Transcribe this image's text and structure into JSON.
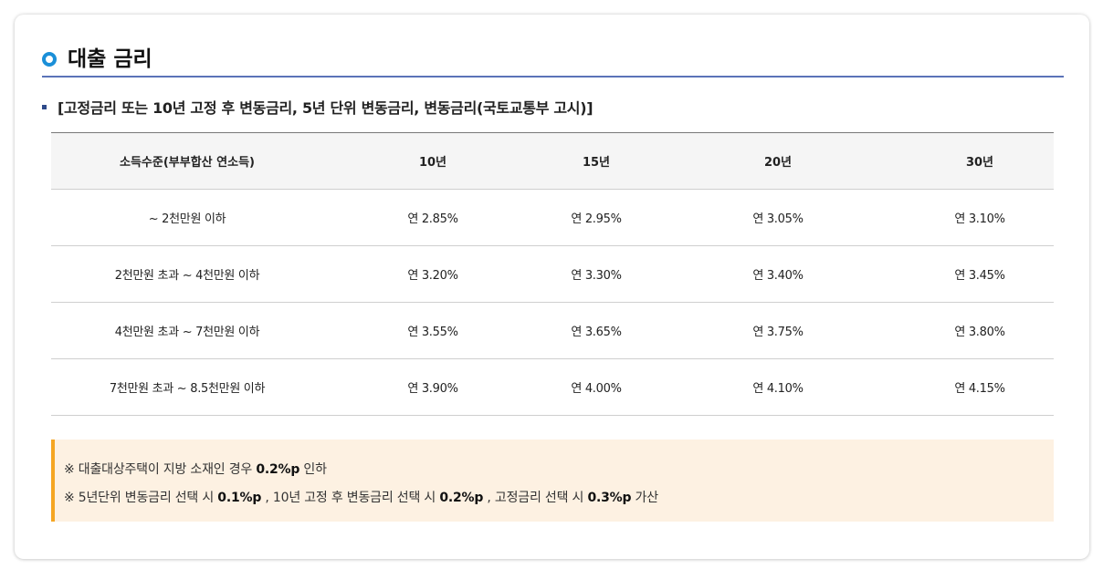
{
  "section": {
    "title": "대출 금리",
    "subtitle": "[고정금리 또는 10년 고정 후 변동금리, 5년 단위 변동금리, 변동금리(국토교통부 고시)]"
  },
  "table": {
    "headers": [
      "소득수준(부부합산 연소득)",
      "10년",
      "15년",
      "20년",
      "30년"
    ],
    "rows": [
      [
        "~ 2천만원 이하",
        "연 2.85%",
        "연 2.95%",
        "연 3.05%",
        "연 3.10%"
      ],
      [
        "2천만원 초과 ~ 4천만원 이하",
        "연 3.20%",
        "연 3.30%",
        "연 3.40%",
        "연 3.45%"
      ],
      [
        "4천만원 초과 ~ 7천만원 이하",
        "연 3.55%",
        "연 3.65%",
        "연 3.75%",
        "연 3.80%"
      ],
      [
        "7천만원 초과 ~ 8.5천만원 이하",
        "연 3.90%",
        "연 4.00%",
        "연 4.10%",
        "연 4.15%"
      ]
    ]
  },
  "notes": {
    "line1": {
      "text": "※ 대출대상주택이 지방 소재인 경우 ",
      "bold": "0.2%p",
      "tail": " 인하"
    },
    "line2": {
      "a": "※ 5년단위 변동금리 선택 시 ",
      "b1": "0.1%p",
      "c": " , 10년 고정 후 변동금리 선택 시 ",
      "b2": "0.2%p",
      "d": " , 고정금리 선택 시 ",
      "b3": "0.3%p",
      "e": " 가산"
    }
  },
  "colors": {
    "accent_blue": "#1a8fd8",
    "rule_blue": "#5b73b8",
    "note_bg": "#fdf1e2",
    "note_border": "#f5a623"
  }
}
